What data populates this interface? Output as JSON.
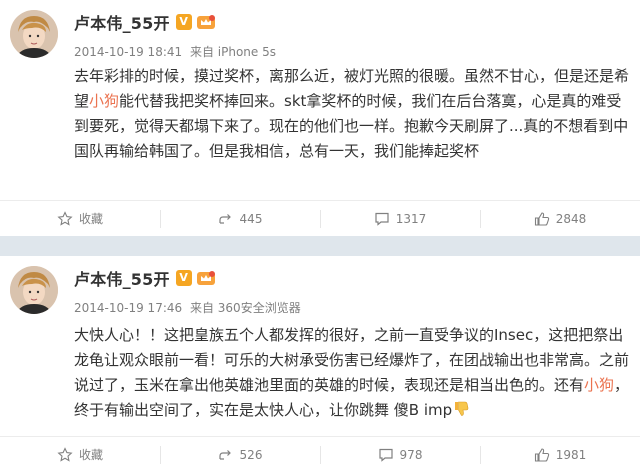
{
  "posts": [
    {
      "username": "卢本伟_55开",
      "v_badge": "V",
      "date": "2014-10-19 18:41",
      "source": "来自 iPhone 5s",
      "content_parts": [
        "去年彩排的时候，摸过奖杯，离那么近，被灯光照的很暖。虽然不甘心，但是还是希望",
        "小狗",
        "能代替我把奖杯捧回来。skt拿奖杯的时候，我们在后台落寞，心是真的难受到要死，觉得天都塌下来了。现在的他们也一样。抱歉今天刷屏了...真的不想看到中国队再输给韩国了。但是我相信，总有一天，我们能捧起奖杯"
      ],
      "actions": {
        "favorite": "收藏",
        "repost": "445",
        "comment": "1317",
        "like": "2848"
      }
    },
    {
      "username": "卢本伟_55开",
      "v_badge": "V",
      "date": "2014-10-19 17:46",
      "source": "来自 360安全浏览器",
      "content_parts": [
        "大快人心！！这把皇族五个人都发挥的很好，之前一直受争议的Insec，这把把祭出龙龟让观众眼前一看！可乐的大树承受伤害已经爆炸了，在团战输出也非常高。之前说过了，玉米在拿出他英雄池里面的英雄的时候，表现还是相当出色的。还有",
        "小狗",
        "，终于有输出空间了，实在是太快人心，让你跳舞 傻B imp"
      ],
      "actions": {
        "favorite": "收藏",
        "repost": "526",
        "comment": "978",
        "like": "1981"
      }
    }
  ],
  "colors": {
    "mention": "#eb7350",
    "divider": "#dfe6ec",
    "v_badge": "#f5a623"
  }
}
